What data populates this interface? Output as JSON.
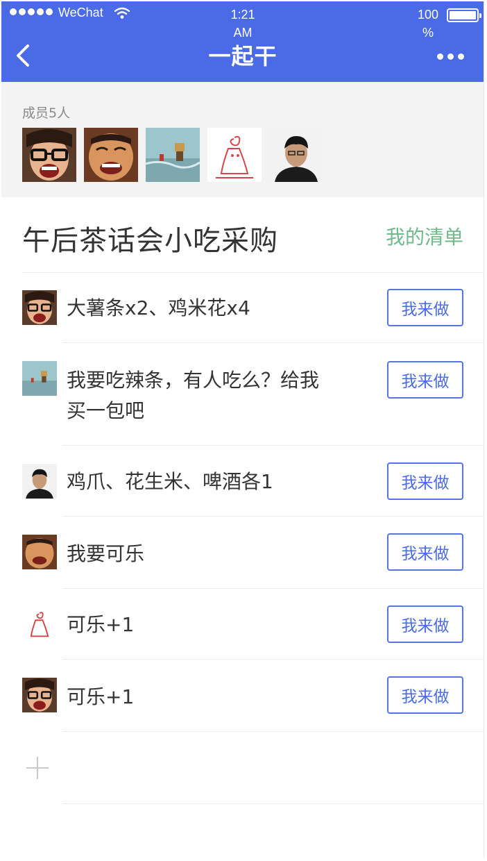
{
  "status_bar": {
    "carrier": "WeChat",
    "time_line1": "1:21",
    "time_line2": "AM",
    "battery_line1": "100",
    "battery_line2": "%",
    "signal_icon": "signal-dots-icon",
    "wifi_icon": "wifi-icon",
    "battery_level": 1.0
  },
  "nav": {
    "title": "一起干",
    "back_icon": "chevron-left-icon",
    "more_icon": "more-dots-icon"
  },
  "members": {
    "label": "成员5人",
    "avatars": [
      "girl-glasses",
      "laughing-man",
      "toy-figure",
      "sketch-drawing",
      "young-man"
    ]
  },
  "list": {
    "title": "午后茶话会小吃采购",
    "my_list_label": "我的清单",
    "items": [
      {
        "avatar": "girl-glasses",
        "text": "大薯条x2、鸡米花x4",
        "action": "我来做"
      },
      {
        "avatar": "toy-figure",
        "text": "我要吃辣条，有人吃么？给我买一包吧",
        "action": "我来做"
      },
      {
        "avatar": "young-man",
        "text": "鸡爪、花生米、啤酒各1",
        "action": "我来做"
      },
      {
        "avatar": "laughing-man",
        "text": "我要可乐",
        "action": "我来做"
      },
      {
        "avatar": "sketch-drawing",
        "text": "可乐+1",
        "action": "我来做"
      },
      {
        "avatar": "girl-glasses",
        "text": "可乐+1",
        "action": "我来做"
      }
    ],
    "add_icon": "plus-icon"
  },
  "colors": {
    "header_bg": "#4a6ae6",
    "accent_green": "#6fb98b",
    "button_border": "#5574e0",
    "members_bg": "#f3f3f3"
  }
}
